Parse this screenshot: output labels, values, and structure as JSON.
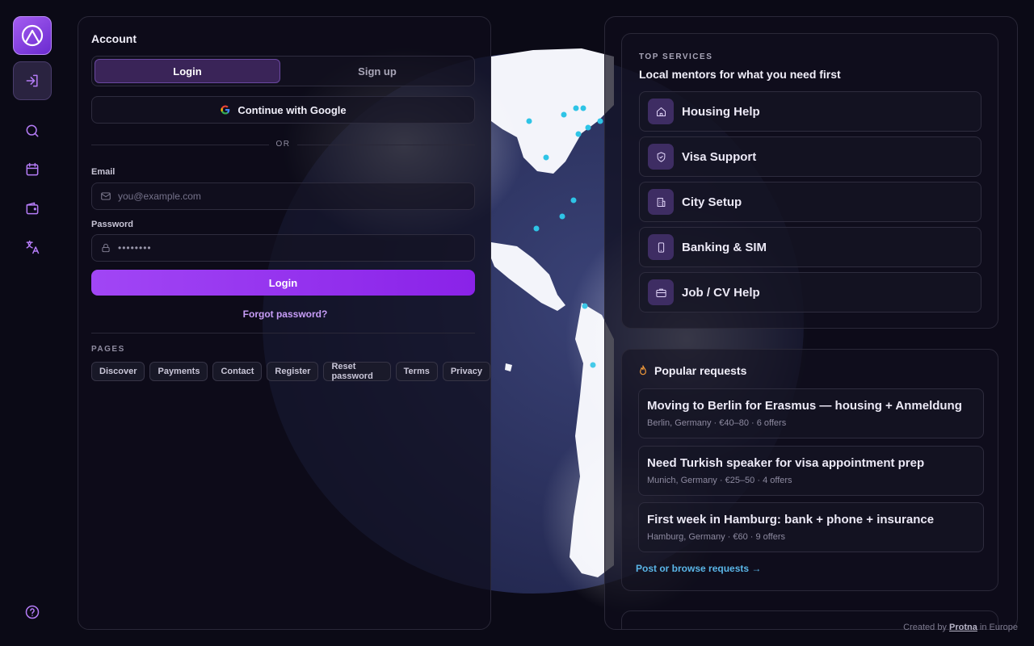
{
  "rail": {
    "items": [
      {
        "name": "sign-in-icon"
      },
      {
        "name": "search-icon"
      },
      {
        "name": "calendar-icon"
      },
      {
        "name": "wallet-icon"
      },
      {
        "name": "translate-icon"
      },
      {
        "name": "help-icon"
      }
    ]
  },
  "account": {
    "title": "Account",
    "tabs": {
      "login": "Login",
      "signup": "Sign up"
    },
    "google_label": "Continue with Google",
    "or_label": "OR",
    "email_label": "Email",
    "email_placeholder": "you@example.com",
    "password_label": "Password",
    "password_value": "••••••••",
    "login_button": "Login",
    "forgot_link": "Forgot password?",
    "pages_title": "PAGES",
    "pages": [
      "Discover",
      "Payments",
      "Contact",
      "Register",
      "Reset password",
      "Terms",
      "Privacy"
    ]
  },
  "services": {
    "kicker": "TOP SERVICES",
    "title": "Local mentors for what you need first",
    "items": [
      {
        "label": "Housing Help",
        "icon": "home-icon"
      },
      {
        "label": "Visa Support",
        "icon": "shield-icon"
      },
      {
        "label": "City Setup",
        "icon": "building-icon"
      },
      {
        "label": "Banking & SIM",
        "icon": "phone-icon"
      },
      {
        "label": "Job / CV Help",
        "icon": "briefcase-icon"
      }
    ]
  },
  "popular": {
    "title": "Popular requests",
    "icon": "flame-icon",
    "requests": [
      {
        "title": "Moving to Berlin for Erasmus — housing + Anmeldung",
        "meta": "Berlin, Germany · €40–80 · 6 offers"
      },
      {
        "title": "Need Turkish speaker for visa appointment prep",
        "meta": "Munich, Germany · €25–50 · 4 offers"
      },
      {
        "title": "First week in Hamburg: bank + phone + insurance",
        "meta": "Hamburg, Germany · €60 · 9 offers"
      }
    ],
    "link": "Post or browse requests →"
  },
  "footer": {
    "prefix": "Created by",
    "brand": "Protna",
    "suffix": "in Europe"
  },
  "colors": {
    "accent": "#a146f5",
    "link": "#5ab6e8",
    "background": "#0b0a16",
    "globe": "#2f3566",
    "marker": "#2ec4e6"
  }
}
